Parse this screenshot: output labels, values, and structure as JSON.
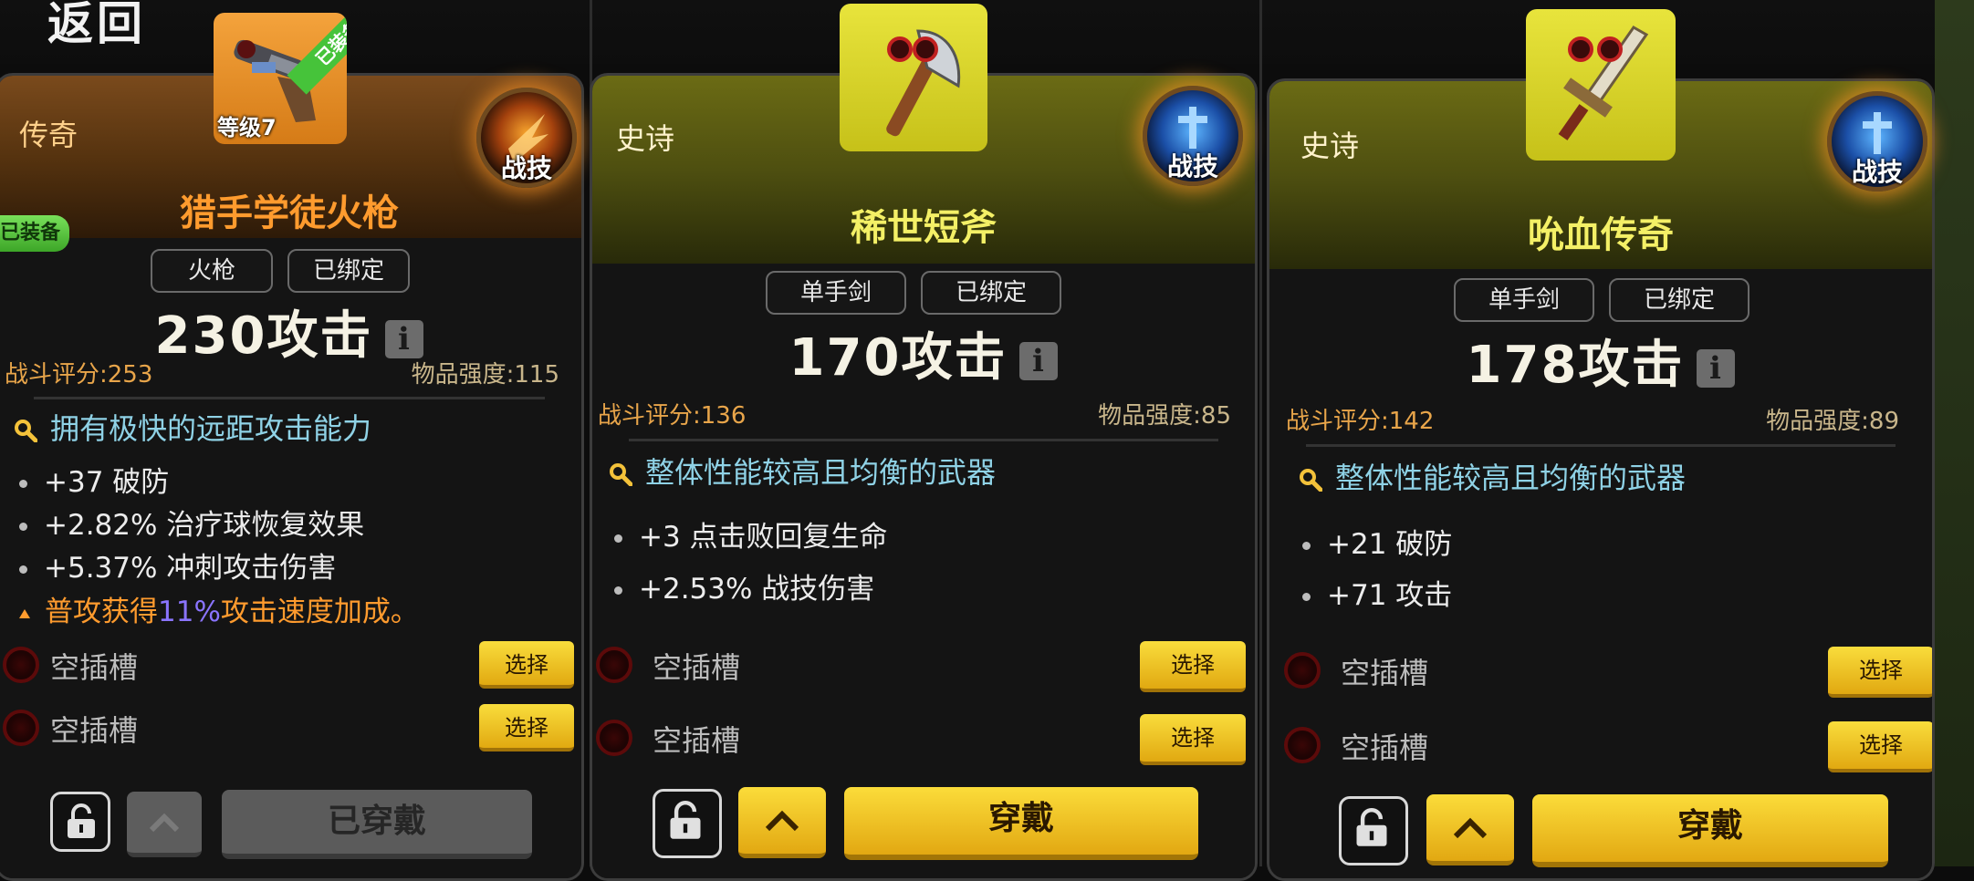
{
  "back_label": "返回",
  "cards": [
    {
      "rarity": "传奇",
      "name": "猎手学徒火枪",
      "level_badge": "等级7",
      "ribbon": "已装备",
      "equipped_tag": "已装备",
      "skill_label": "战技",
      "tags": [
        "火枪",
        "已绑定"
      ],
      "attack": "230攻击",
      "info": "i",
      "score": "战斗评分:253",
      "strength": "物品强度:115",
      "description": "拥有极快的远距攻击能力",
      "stats": [
        "+37 破防",
        "+2.82% 治疗球恢复效果",
        "+5.37% 冲刺攻击伤害"
      ],
      "special": {
        "prefix": "普攻获得",
        "highlight": "11%",
        "suffix": "攻击速度加成。"
      },
      "sockets": [
        {
          "label": "空插槽",
          "button": "选择"
        },
        {
          "label": "空插槽",
          "button": "选择"
        }
      ],
      "wear_label": "已穿戴"
    },
    {
      "rarity": "史诗",
      "name": "稀世短斧",
      "skill_label": "战技",
      "tags": [
        "单手剑",
        "已绑定"
      ],
      "attack": "170攻击",
      "info": "i",
      "score": "战斗评分:136",
      "strength": "物品强度:85",
      "description": "整体性能较高且均衡的武器",
      "stats": [
        "+3 点击败回复生命",
        "+2.53% 战技伤害"
      ],
      "sockets": [
        {
          "label": "空插槽",
          "button": "选择"
        },
        {
          "label": "空插槽",
          "button": "选择"
        }
      ],
      "wear_label": "穿戴"
    },
    {
      "rarity": "史诗",
      "name": "吮血传奇",
      "skill_label": "战技",
      "tags": [
        "单手剑",
        "已绑定"
      ],
      "attack": "178攻击",
      "info": "i",
      "score": "战斗评分:142",
      "strength": "物品强度:89",
      "description": "整体性能较高且均衡的武器",
      "stats": [
        "+21 破防",
        "+71 攻击"
      ],
      "sockets": [
        {
          "label": "空插槽",
          "button": "选择"
        },
        {
          "label": "空插槽",
          "button": "选择"
        }
      ],
      "wear_label": "穿戴"
    }
  ],
  "colors": {
    "legend_name": "#ff9b2e",
    "epic_name": "#f4f066",
    "score": "#e8a54a",
    "description": "#8fd2e6",
    "highlight": "#8a74ff",
    "button_gold": "#f9dd3c",
    "equipped_green": "#46c33a"
  },
  "icons": {
    "card1_item": "flintlock-gun-icon",
    "card2_item": "axe-icon",
    "card3_item": "sword-icon",
    "skill_fire": "fire-skill-icon",
    "skill_ice": "ice-skill-icon",
    "lock": "unlock-icon",
    "search": "magnifier-icon",
    "upgrade": "chevron-up-icon"
  }
}
